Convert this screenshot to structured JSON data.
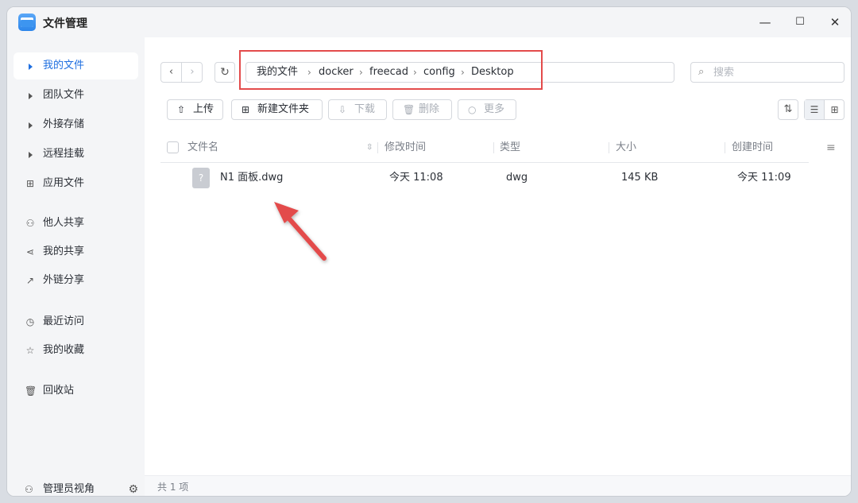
{
  "window": {
    "title": "文件管理",
    "controls": [
      "—",
      "☐",
      "✕"
    ]
  },
  "sidebar": {
    "items": [
      {
        "label": "我的文件",
        "icon": "caret-right-icon",
        "active": true
      },
      {
        "label": "团队文件",
        "icon": "caret-right-icon"
      },
      {
        "label": "外接存储",
        "icon": "caret-right-icon"
      },
      {
        "label": "远程挂载",
        "icon": "caret-right-icon"
      },
      {
        "label": "应用文件",
        "icon": "grid-icon"
      },
      {
        "label": "他人共享",
        "icon": "users-icon"
      },
      {
        "label": "我的共享",
        "icon": "share-icon"
      },
      {
        "label": "外链分享",
        "icon": "external-link-icon"
      },
      {
        "label": "最近访问",
        "icon": "clock-icon"
      },
      {
        "label": "我的收藏",
        "icon": "star-icon"
      },
      {
        "label": "回收站",
        "icon": "trash-icon"
      }
    ],
    "admin_label": "管理员视角"
  },
  "path": {
    "crumbs": [
      "我的文件",
      "docker",
      "freecad",
      "config",
      "Desktop"
    ]
  },
  "search": {
    "placeholder": "搜索"
  },
  "toolbar": {
    "upload": "上传",
    "new_folder": "新建文件夹",
    "download": "下载",
    "delete": "删除",
    "more": "更多"
  },
  "table": {
    "headers": [
      "文件名",
      "修改时间",
      "类型",
      "大小",
      "创建时间"
    ],
    "rows": [
      {
        "name": "N1 面板.dwg",
        "modified": "今天 11:08",
        "type": "dwg",
        "size": "145 KB",
        "created": "今天 11:09"
      }
    ]
  },
  "footer": {
    "count": "共 1 项"
  },
  "annotation": {
    "color": "#e34b4b"
  }
}
